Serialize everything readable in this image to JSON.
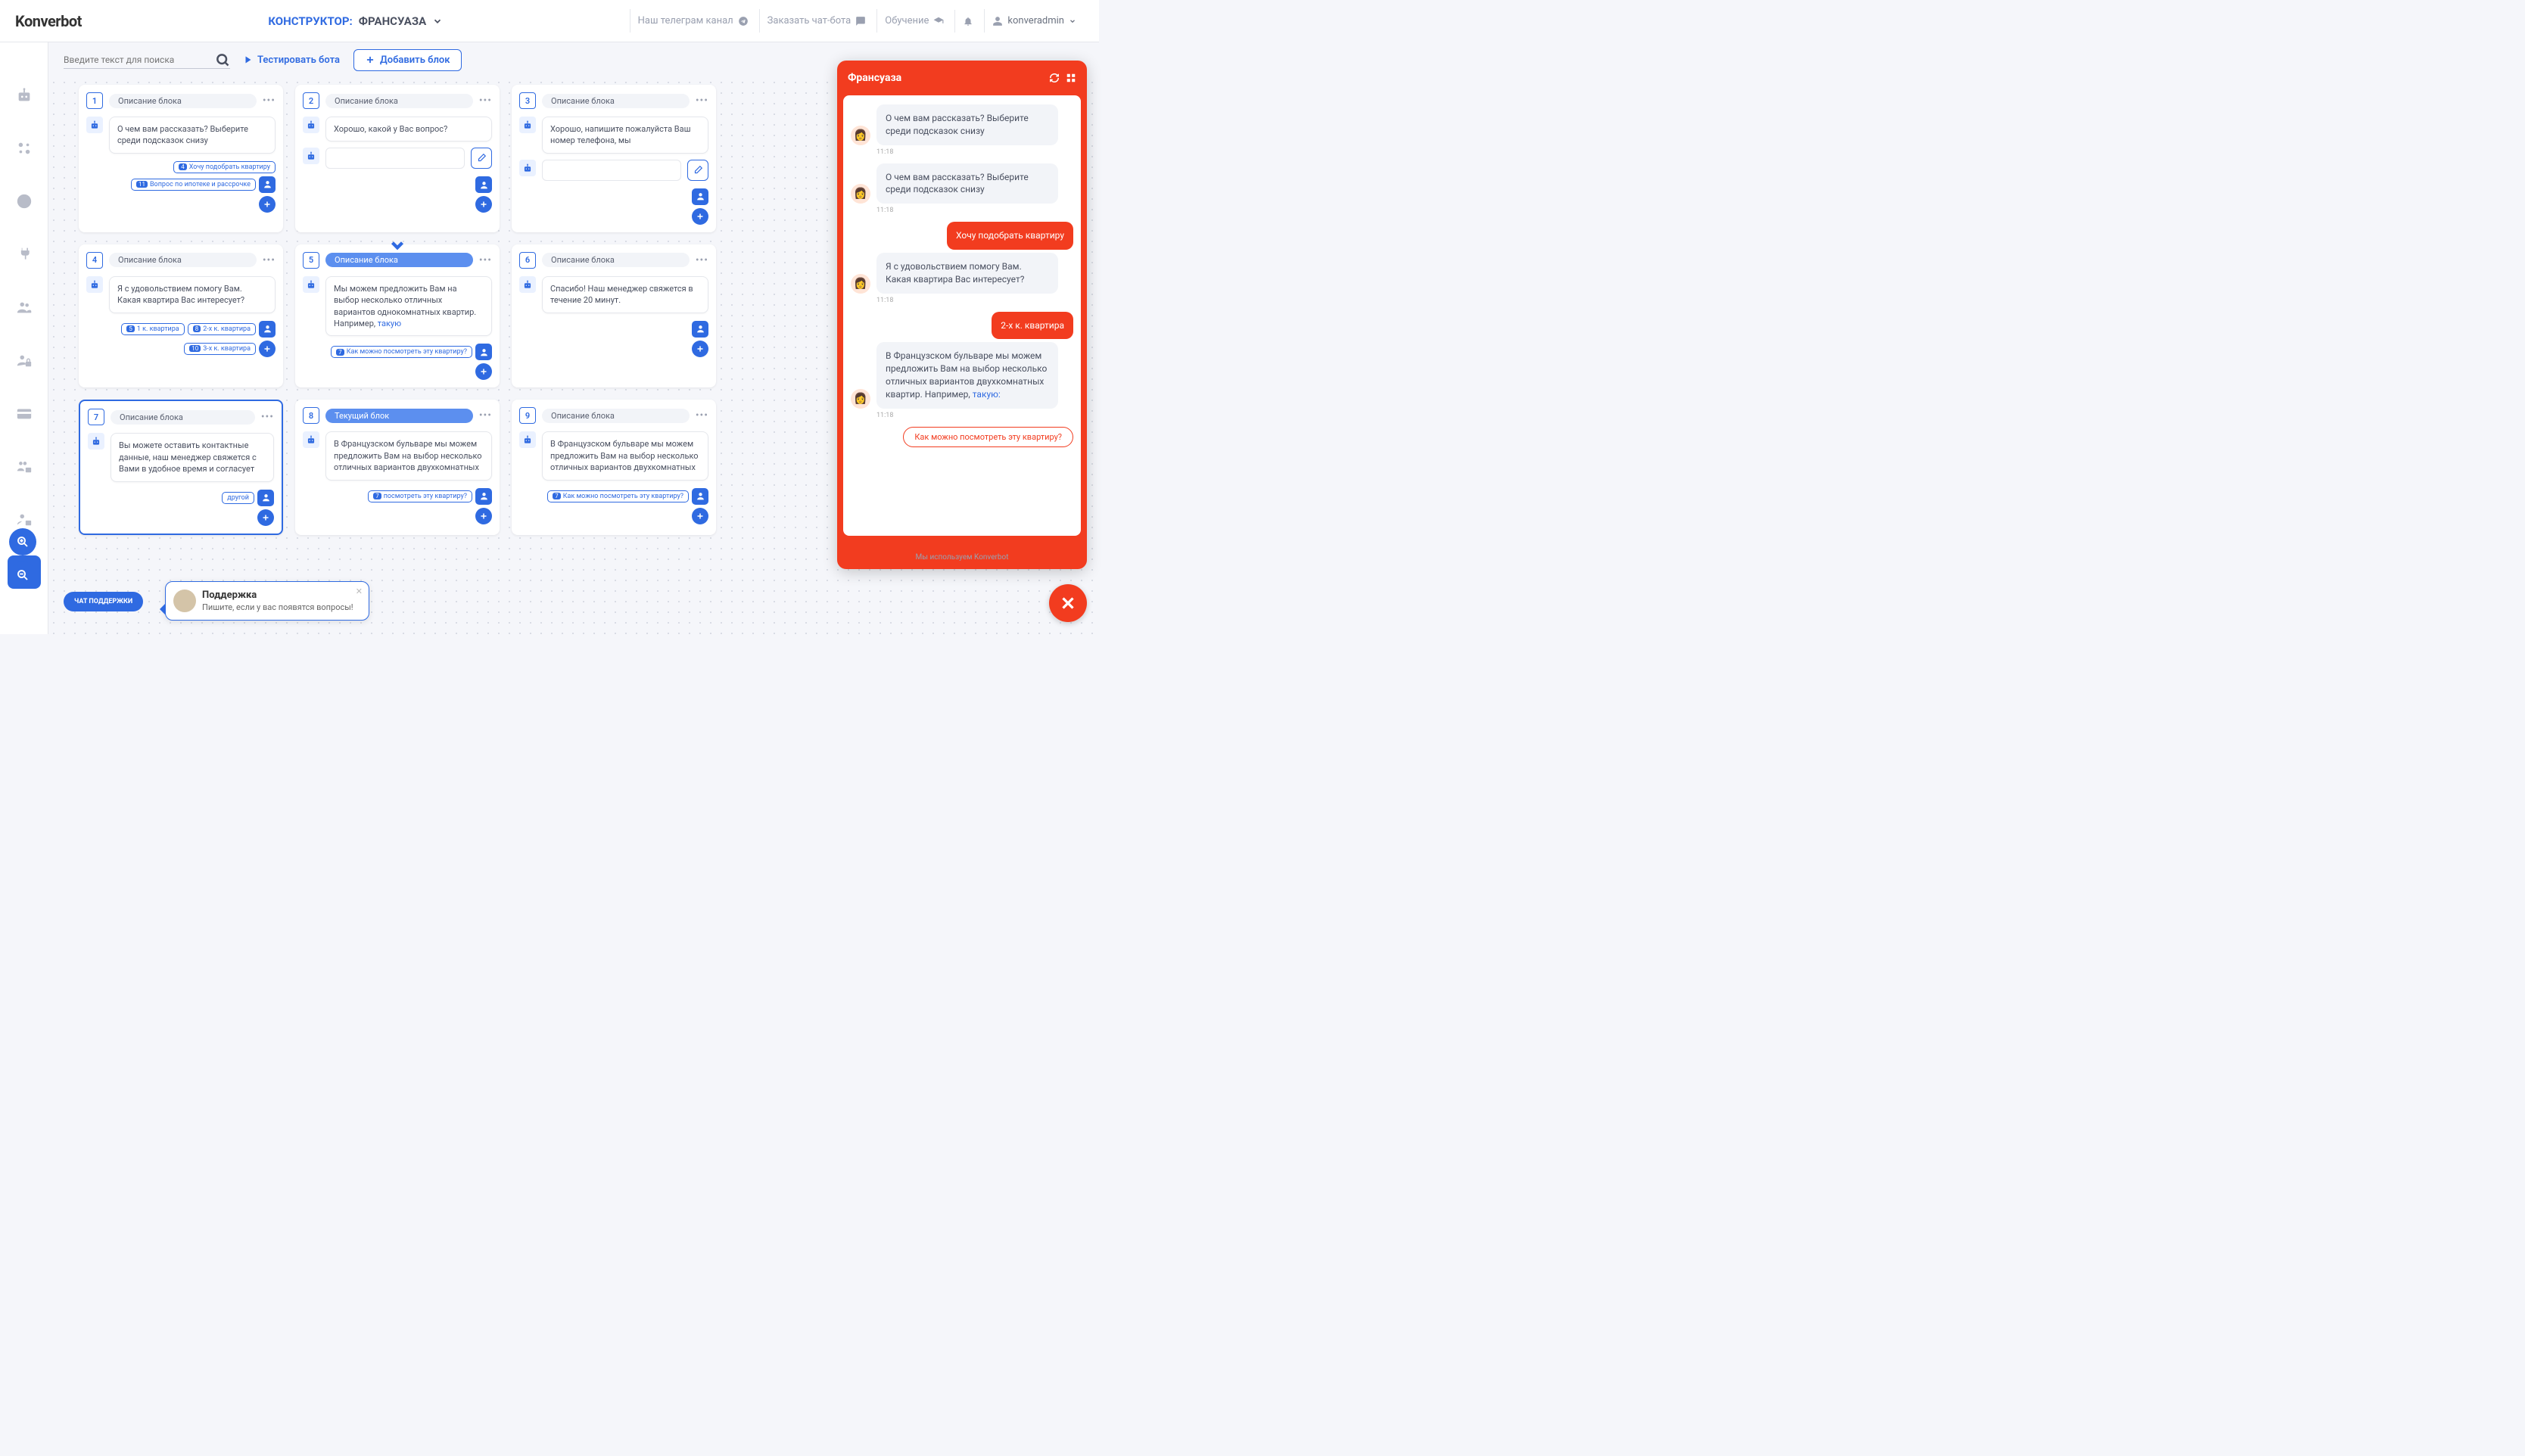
{
  "header": {
    "logo": "Konverbot",
    "constructor_label": "КОНСТРУКТОР:",
    "bot_name": "ФРАНСУАЗА",
    "links": {
      "telegram": "Наш телеграм канал",
      "order": "Заказать чат-бота",
      "learn": "Обучение"
    },
    "user": "konveradmin"
  },
  "toolbar": {
    "search_placeholder": "Введите текст для поиска",
    "test_label": "Тестировать бота",
    "add_block_label": "Добавить блок"
  },
  "blocks": [
    {
      "num": "1",
      "title": "Описание блока",
      "msg": "О чем вам рассказать? Выберите среди подсказок снизу",
      "opts": [
        {
          "n": "4",
          "t": "Хочу подобрать квартиру"
        },
        {
          "n": "11",
          "t": "Вопрос по ипотеке и рассрочке"
        }
      ]
    },
    {
      "num": "2",
      "title": "Описание блока",
      "msg": "Хорошо, какой у Вас вопрос?",
      "has_input": true,
      "opts": []
    },
    {
      "num": "3",
      "title": "Описание блока",
      "msg": "Хорошо, напишите пожалуйста Ваш номер телефона, мы",
      "has_input": true,
      "opts": []
    },
    {
      "num": "4",
      "title": "Описание блока",
      "msg": "Я с удовольствием помогу Вам. Какая квартира Вас интересует?",
      "opts": [
        {
          "n": "5",
          "t": "1 к. квартира"
        },
        {
          "n": "8",
          "t": "2-х к. квартира"
        },
        {
          "n": "10",
          "t": "3-х к. квартира"
        }
      ]
    },
    {
      "num": "5",
      "title": "Описание блока",
      "hl": true,
      "arrow": true,
      "msg_html": "Мы можем предложить Вам на выбор несколько отличных вариантов однокомнатных квартир. Например, <span class='link-text'>такую</span>",
      "opts": [
        {
          "n": "7",
          "t": "Как можно посмотреть эту квартиру?"
        }
      ]
    },
    {
      "num": "6",
      "title": "Описание блока",
      "msg": "Спасибо! Наш менеджер свяжется в течение 20 минут.",
      "opts": []
    },
    {
      "num": "7",
      "title": "Описание блока",
      "selected": true,
      "msg": "Вы можете оставить контактные данные, наш менеджер свяжется с Вами в удобное время и согласует",
      "opts": [
        {
          "n": "",
          "t": "другой"
        }
      ]
    },
    {
      "num": "8",
      "title": "Текущий блок",
      "hl": true,
      "msg": "В Французском бульваре мы можем предложить Вам на выбор несколько отличных вариантов двухкомнатных",
      "opts": [
        {
          "n": "7",
          "t": "посмотреть эту квартиру?"
        }
      ]
    },
    {
      "num": "9",
      "title": "Описание блока",
      "msg": "В Французском бульваре мы можем предложить Вам на выбор несколько отличных вариантов двухкомнатных",
      "opts": [
        {
          "n": "7",
          "t": "Как можно посмотреть эту квартиру?"
        }
      ]
    }
  ],
  "support": {
    "pill": "ЧАТ ПОДДЕРЖКИ",
    "title": "Поддержка",
    "text": "Пишите, если у вас появятся вопросы!"
  },
  "chat": {
    "title": "Франсуаза",
    "footer": "Мы используем Konverbot",
    "messages": [
      {
        "who": "bot",
        "text": "О чем вам рассказать? Выберите среди подсказок снизу",
        "time": "11:18"
      },
      {
        "who": "bot",
        "text": "О чем вам рассказать? Выберите среди подсказок снизу",
        "time": "11:18"
      },
      {
        "who": "user",
        "text": "Хочу подобрать квартиру",
        "time": ""
      },
      {
        "who": "bot",
        "text": "Я с удовольствием помогу Вам. Какая квартира Вас интересует?",
        "time": "11:18"
      },
      {
        "who": "user",
        "text": "2-х к. квартира",
        "time": ""
      },
      {
        "who": "bot",
        "text_html": "В Французском бульваре мы можем предложить Вам на выбор несколько отличных вариантов двухкомнатных квартир. Например, <span class='link-text'>такую:</span>",
        "time": "11:18"
      }
    ],
    "suggest": "Как можно посмотреть эту квартиру?"
  }
}
